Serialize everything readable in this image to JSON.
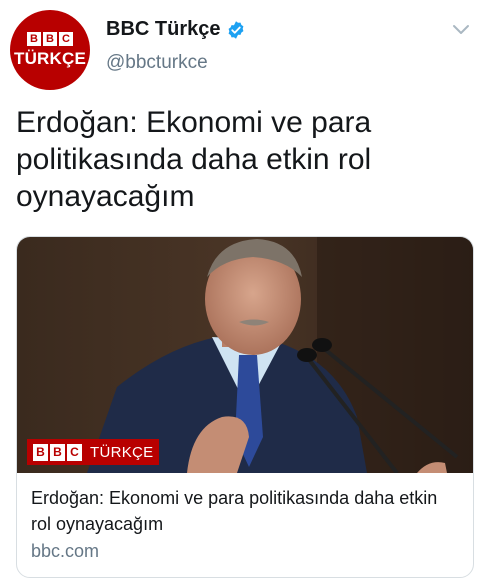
{
  "author": {
    "avatar_logo": [
      "B",
      "B",
      "C"
    ],
    "avatar_text": "TÜRKÇE",
    "display_name": "BBC Türkçe",
    "handle": "@bbcturkce"
  },
  "tweet": {
    "text": "Erdoğan: Ekonomi ve para politikasında daha etkin rol oynayacağım"
  },
  "card": {
    "badge_logo": [
      "B",
      "B",
      "C"
    ],
    "badge_text": "TÜRKÇE",
    "title": "Erdoğan: Ekonomi ve para politikasında daha etkin rol oynayacağım",
    "domain": "bbc.com"
  },
  "icons": {
    "verified": "verified-badge-icon",
    "menu": "chevron-down-icon"
  },
  "colors": {
    "brand_red": "#b80000",
    "verified_blue": "#1da1f2",
    "secondary_text": "#657786"
  }
}
